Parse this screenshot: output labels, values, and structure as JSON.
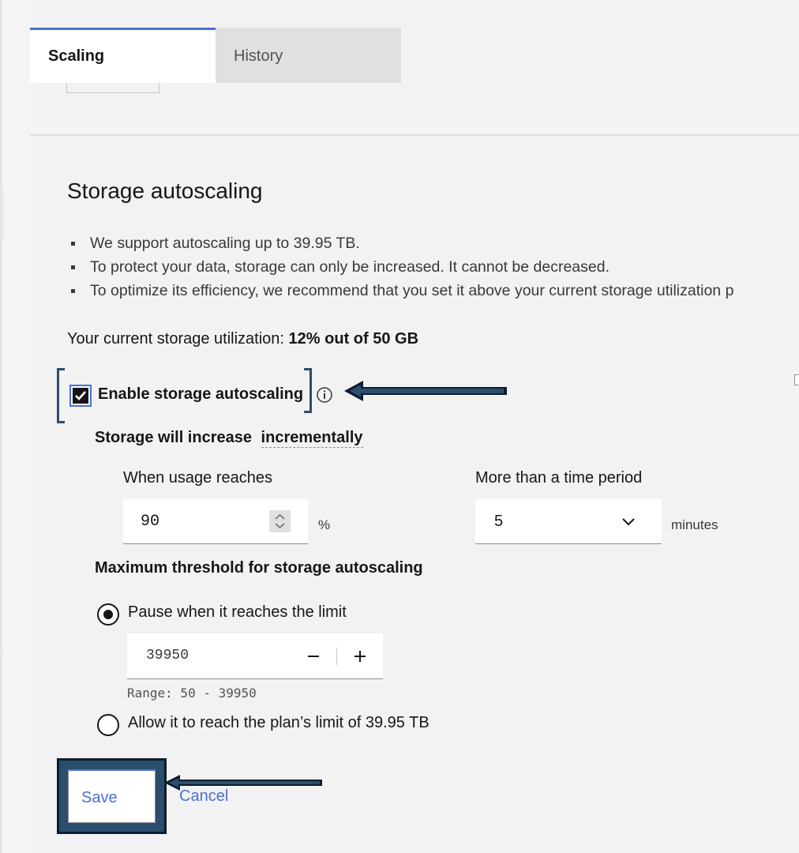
{
  "tabs": [
    {
      "label": "Scaling",
      "active": true
    },
    {
      "label": "History",
      "active": false
    }
  ],
  "section": {
    "title": "Storage autoscaling",
    "bullets": [
      "We support autoscaling up to 39.95 TB.",
      "To protect your data, storage can only be increased. It cannot be decreased.",
      "To optimize its efficiency, we recommend that you set it above your current storage utilization p"
    ],
    "utilization_prefix": "Your current storage utilization:",
    "utilization_value": "12% out of 50 GB"
  },
  "autoscaling": {
    "checkbox_label": "Enable storage autoscaling",
    "checked": true,
    "increase_prefix": "Storage will increase",
    "increase_mode": "incrementally",
    "usage_label": "When usage reaches",
    "usage_value": "90",
    "usage_unit": "%",
    "period_label": "More than a time period",
    "period_value": "5",
    "period_unit": "minutes"
  },
  "threshold": {
    "title": "Maximum threshold for storage autoscaling",
    "option_pause": "Pause when it reaches the limit",
    "limit_value": "39950",
    "range_text": "Range: 50 - 39950",
    "option_allow": "Allow it to reach the plan’s limit of 39.95 TB",
    "selected": "pause"
  },
  "actions": {
    "save_label": "Save",
    "cancel_label": "Cancel"
  },
  "colors": {
    "accent": "#4a6fd8",
    "annotation": "#2b4d6e"
  }
}
